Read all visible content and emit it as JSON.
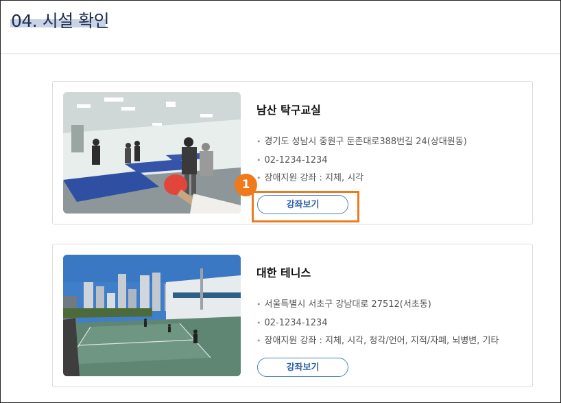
{
  "page": {
    "title": "04. 시설 확인"
  },
  "facilities": [
    {
      "name": "남산 탁구교실",
      "address": "경기도 성남시 중원구 둔촌대로388번길 24(상대원동)",
      "phone": "02-1234-1234",
      "courses": "장애지원 강좌 : 지체, 시각",
      "button_label": "강좌보기",
      "image_subject": "table-tennis-room"
    },
    {
      "name": "대한 테니스",
      "address": "서울특별시 서초구 강남대로 27512(서초동)",
      "phone": "02-1234-1234",
      "courses": "장애지원 강좌 : 지체, 시각, 청각/언어, 지적/자폐, 뇌병변, 기타",
      "button_label": "강좌보기",
      "image_subject": "tennis-court"
    }
  ],
  "annotation": {
    "step_number": "1",
    "color": "#f07a1b"
  }
}
